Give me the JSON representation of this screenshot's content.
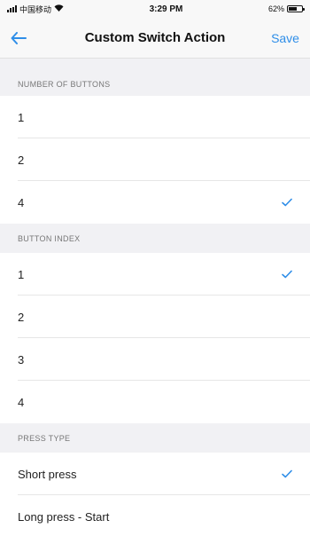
{
  "status_bar": {
    "carrier": "中国移动",
    "time": "3:29 PM",
    "battery_percent": "62%"
  },
  "nav": {
    "title": "Custom Switch Action",
    "save_label": "Save"
  },
  "sections": {
    "number_of_buttons": {
      "header": "NUMBER OF BUTTONS",
      "options": [
        "1",
        "2",
        "4"
      ],
      "selected": "4"
    },
    "button_index": {
      "header": "BUTTON INDEX",
      "options": [
        "1",
        "2",
        "3",
        "4"
      ],
      "selected": "1"
    },
    "press_type": {
      "header": "PRESS TYPE",
      "options": [
        "Short press",
        "Long press - Start"
      ],
      "selected": "Short press"
    }
  },
  "colors": {
    "accent": "#2f8ee8",
    "section_background": "#f1f1f4"
  }
}
